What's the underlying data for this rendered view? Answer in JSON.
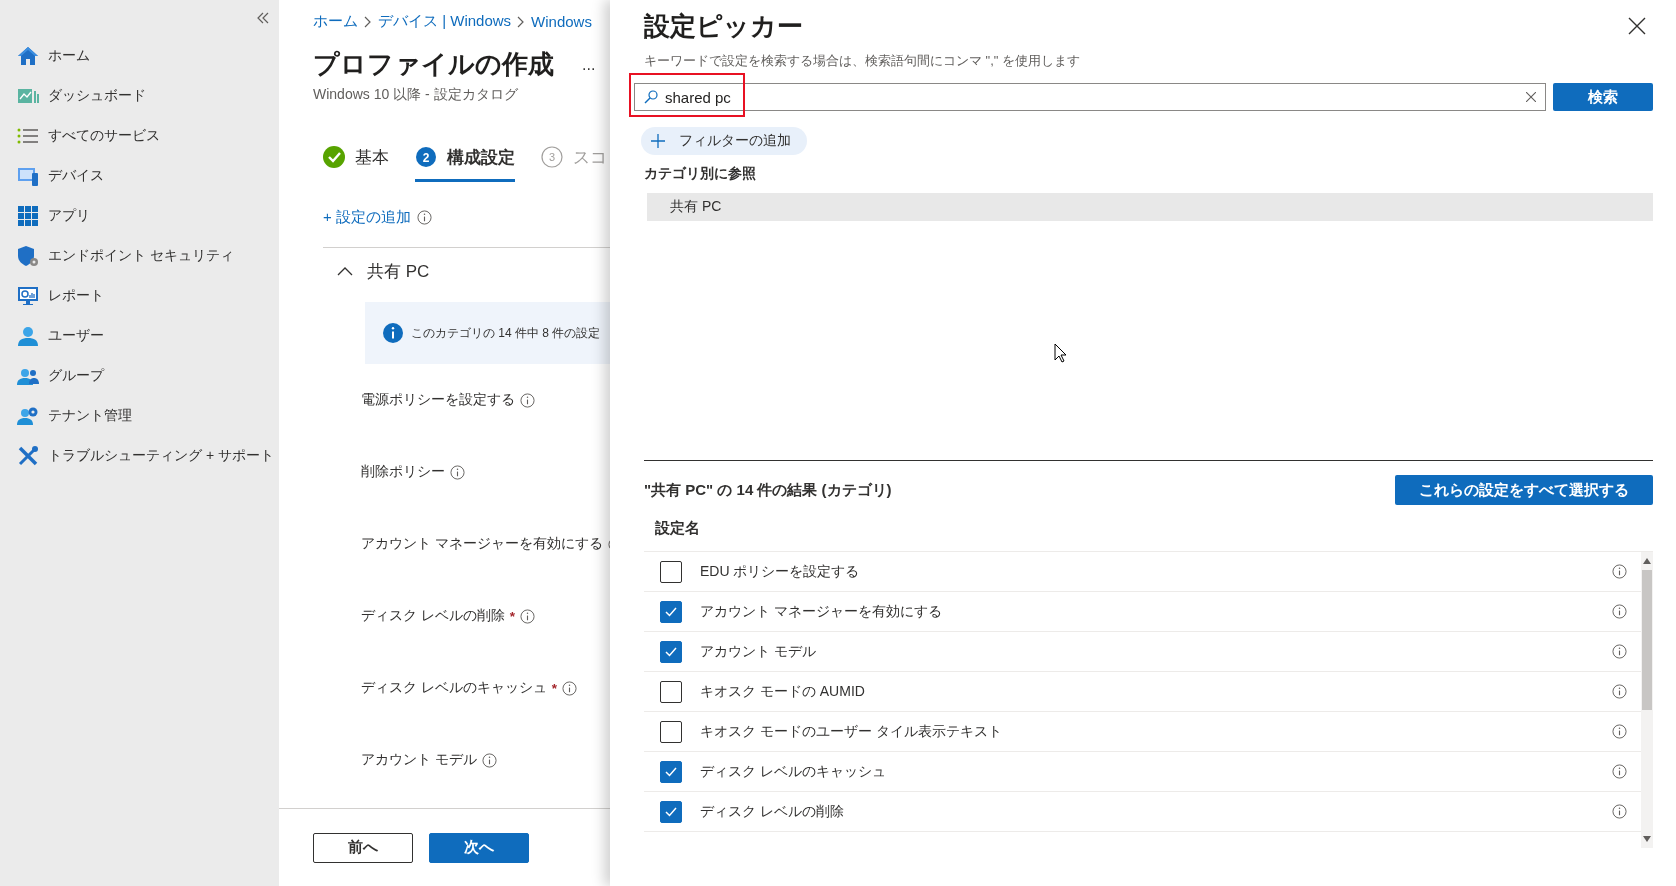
{
  "sidebar": {
    "items": [
      {
        "label": "ホーム"
      },
      {
        "label": "ダッシュボード"
      },
      {
        "label": "すべてのサービス"
      },
      {
        "label": "デバイス"
      },
      {
        "label": "アプリ"
      },
      {
        "label": "エンドポイント セキュリティ"
      },
      {
        "label": "レポート"
      },
      {
        "label": "ユーザー"
      },
      {
        "label": "グループ"
      },
      {
        "label": "テナント管理"
      },
      {
        "label": "トラブルシューティング + サポート"
      }
    ]
  },
  "breadcrumb": [
    "ホーム",
    "デバイス | Windows",
    "Windows"
  ],
  "page": {
    "title": "プロファイルの作成",
    "more": "...",
    "subtitle": "Windows 10 以降 - 設定カタログ"
  },
  "steps": [
    {
      "label": "基本",
      "done": true,
      "selected": false
    },
    {
      "number": "2",
      "label": "構成設定",
      "done": false,
      "selected": true
    },
    {
      "number": "3",
      "label": "スコ",
      "done": false,
      "selected": false
    }
  ],
  "add_setting": "+ 設定の追加",
  "group": {
    "title": "共有 PC",
    "expanded": true,
    "info": "このカテゴリの 14 件中 8 件の設定",
    "settings": [
      {
        "label": "電源ポリシーを設定する"
      },
      {
        "label": "削除ポリシー"
      },
      {
        "label": "アカウント マネージャーを有効にする"
      },
      {
        "label": "ディスク レベルの削除",
        "required_mark": "*"
      },
      {
        "label": "ディスク レベルのキャッシュ",
        "required_mark": "*"
      },
      {
        "label": "アカウント モデル"
      }
    ]
  },
  "footer_buttons": [
    {
      "label": "前へ",
      "kind": "secondary"
    },
    {
      "label": "次へ",
      "kind": "primary"
    }
  ],
  "picker": {
    "title": "設定ピッカー",
    "hint": "キーワードで設定を検索する場合は、検索語句間にコンマ \",\" を使用します",
    "search": {
      "value": "shared pc",
      "highlighted": true
    },
    "search_button": "検索",
    "filter_button": "フィルターの追加",
    "browse_label": "カテゴリ別に参照",
    "categories": [
      {
        "label": "共有 PC",
        "selected": true
      }
    ],
    "results": {
      "heading": "\"共有 PC\" の 14 件の結果 (カテゴリ)",
      "select_all": "これらの設定をすべて選択する",
      "column": "設定名",
      "rows": [
        {
          "label": "EDU ポリシーを設定する",
          "checked": false
        },
        {
          "label": "アカウント マネージャーを有効にする",
          "checked": true
        },
        {
          "label": "アカウント モデル",
          "checked": true
        },
        {
          "label": "キオスク モードの AUMID",
          "checked": false
        },
        {
          "label": "キオスク モードのユーザー タイル表示テキスト",
          "checked": false
        },
        {
          "label": "ディスク レベルのキャッシュ",
          "checked": true
        },
        {
          "label": "ディスク レベルの削除",
          "checked": true
        }
      ]
    }
  }
}
